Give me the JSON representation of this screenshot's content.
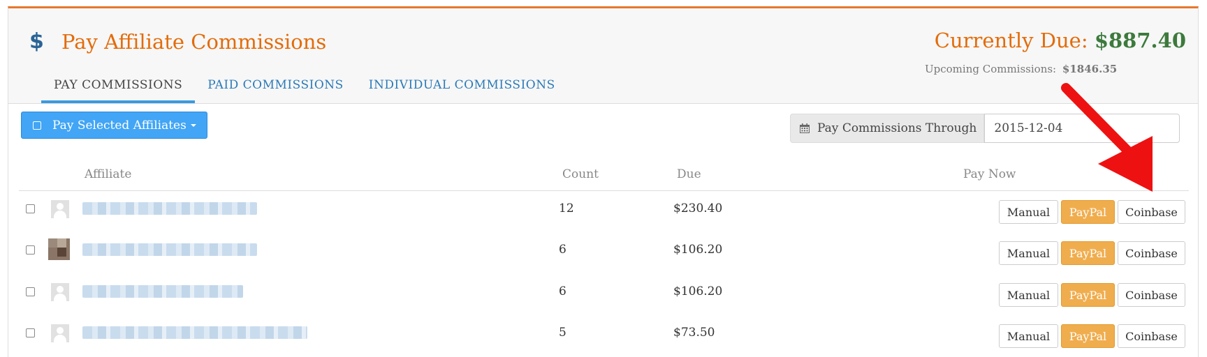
{
  "header": {
    "title_icon": "$",
    "title": "Pay Affiliate Commissions",
    "currently_due_label": "Currently Due:",
    "currently_due_amount": "$887.40",
    "upcoming_label": "Upcoming Commissions:",
    "upcoming_amount": "$1846.35"
  },
  "tabs": [
    {
      "label": "PAY COMMISSIONS",
      "active": true
    },
    {
      "label": "PAID COMMISSIONS",
      "active": false
    },
    {
      "label": "INDIVIDUAL COMMISSIONS",
      "active": false
    }
  ],
  "toolbar": {
    "pay_selected_label": "Pay Selected Affiliates",
    "through_label": "Pay Commissions Through",
    "through_value": "2015-12-04"
  },
  "table": {
    "columns": {
      "affiliate": "Affiliate",
      "count": "Count",
      "due": "Due",
      "pay_now": "Pay Now"
    },
    "rows": [
      {
        "count": "12",
        "due": "$230.40",
        "avatar": "default"
      },
      {
        "count": "6",
        "due": "$106.20",
        "avatar": "photo"
      },
      {
        "count": "6",
        "due": "$106.20",
        "avatar": "default"
      },
      {
        "count": "5",
        "due": "$73.50",
        "avatar": "default"
      }
    ],
    "actions": {
      "manual": "Manual",
      "paypal": "PayPal",
      "coinbase": "Coinbase"
    }
  },
  "colors": {
    "accent_orange": "#e36c0a",
    "due_green": "#3c7a3c",
    "primary_blue": "#42a5f5",
    "paypal_orange": "#f0ad4e",
    "annotation_arrow": "#ee1111"
  },
  "icons": {
    "title": "dollar-icon",
    "through": "calendar-icon",
    "annotation": "red-arrow-annotation"
  }
}
